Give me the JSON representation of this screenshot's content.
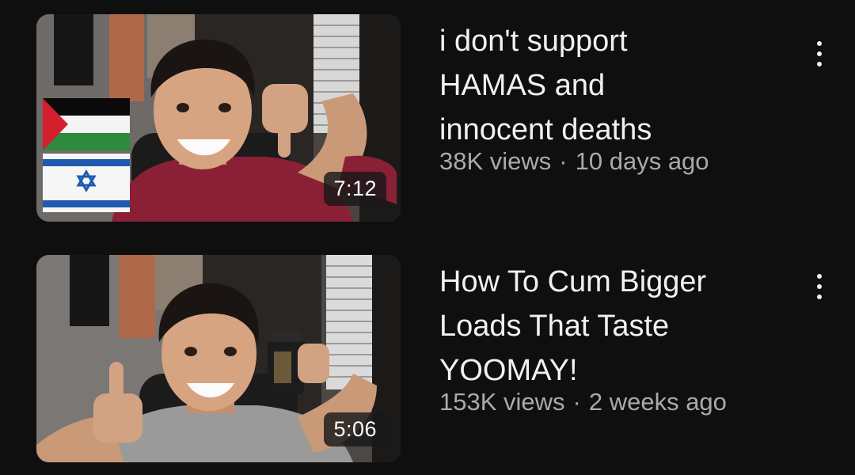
{
  "videos": [
    {
      "title": "i don't support\nHAMAS and\ninnocent deaths",
      "views": "38K views",
      "age": "10 days ago",
      "duration": "7:12",
      "thumb_icons": [
        "palestine-flag-icon",
        "israel-flag-icon",
        "thumbs-down-icon"
      ]
    },
    {
      "title": "How To Cum Bigger\nLoads That Taste\nYOOMAY!",
      "views": "153K views",
      "age": "2 weeks ago",
      "duration": "5:06",
      "thumb_icons": [
        "supplement-bottle-icon",
        "thumbs-up-icon"
      ]
    }
  ],
  "separator": "·",
  "more_icon": "more-vertical-icon",
  "colors": {
    "background": "#0f0f0f",
    "title": "#f1f1f1",
    "meta": "#aaaaaa",
    "shirt_1": "#8a2035",
    "shirt_2": "#9a9a9a"
  }
}
